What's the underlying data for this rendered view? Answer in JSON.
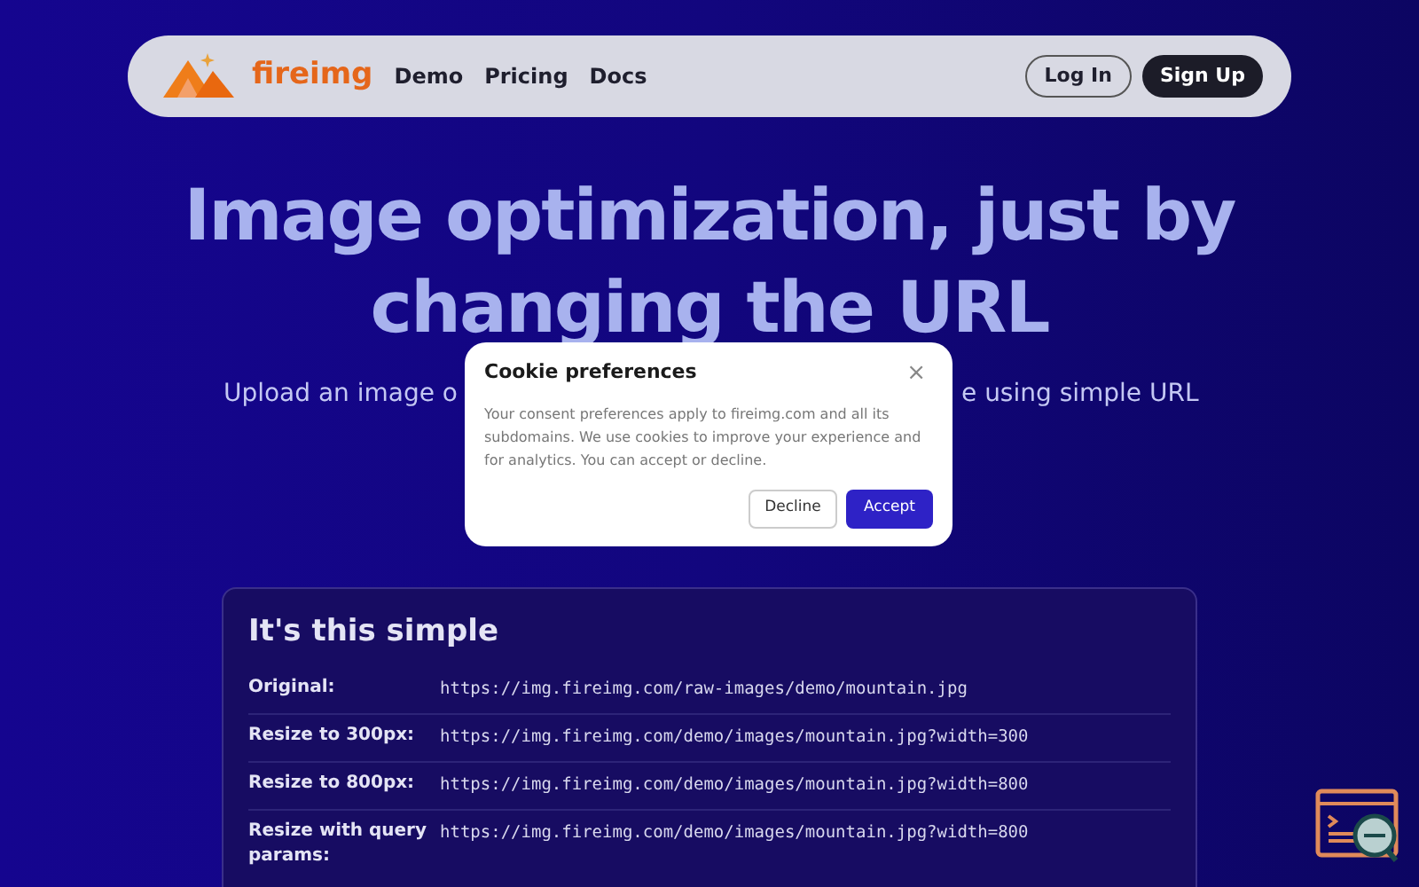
{
  "nav": {
    "brand": "fireimg",
    "links": [
      "Demo",
      "Pricing",
      "Docs"
    ],
    "login": "Log In",
    "signup": "Sign Up"
  },
  "hero": {
    "title_lines": [
      "Image optimization, just by",
      "changing the URL"
    ],
    "subtitle_left": "Upload an image o",
    "subtitle_right": "e using simple URL"
  },
  "card": {
    "title": "It's this simple",
    "rows": [
      {
        "label": "Original:",
        "url": "https://img.fireimg.com/raw-images/demo/mountain.jpg"
      },
      {
        "label": "Resize to 300px:",
        "url": "https://img.fireimg.com/demo/images/mountain.jpg?width=300"
      },
      {
        "label": "Resize to 800px:",
        "url": "https://img.fireimg.com/demo/images/mountain.jpg?width=800"
      },
      {
        "label": "Resize with query params:",
        "url": "https://img.fireimg.com/demo/images/mountain.jpg?width=800"
      }
    ]
  },
  "cookie_dialog": {
    "title": "Cookie preferences",
    "close": "×",
    "body": "Your consent preferences apply to fireimg.com and all its subdomains. We use cookies to improve your experience and for analytics. You can accept or decline.",
    "decline": "Decline",
    "accept": "Accept"
  }
}
